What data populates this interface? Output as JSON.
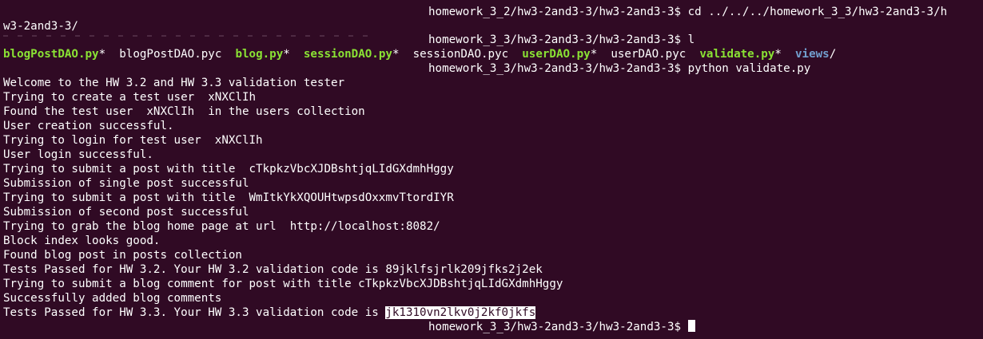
{
  "terminal": {
    "background": "#300a24",
    "foreground": "#ffffff",
    "colors": {
      "executable": "#8ae234",
      "directory": "#729fcf"
    },
    "cd_prompt": "homework_3_2/hw3-2and3-3/hw3-2and3-3$",
    "cd_command": "cd ../../../homework_3_3/hw3-2and3-3/h",
    "cd_wrap": "w3-2and3-3/",
    "ls_prompt": "homework_3_3/hw3-2and3-3/hw3-2and3-3$",
    "ls_command": "l",
    "ls_entries": [
      {
        "name": "blogPostDAO.py",
        "suffix": "*",
        "kind": "executable"
      },
      {
        "name": "blogPostDAO.pyc",
        "suffix": "",
        "kind": "file"
      },
      {
        "name": "blog.py",
        "suffix": "*",
        "kind": "executable"
      },
      {
        "name": "sessionDAO.py",
        "suffix": "*",
        "kind": "executable"
      },
      {
        "name": "sessionDAO.pyc",
        "suffix": "",
        "kind": "file"
      },
      {
        "name": "userDAO.py",
        "suffix": "*",
        "kind": "executable"
      },
      {
        "name": "userDAO.pyc",
        "suffix": "",
        "kind": "file"
      },
      {
        "name": "validate.py",
        "suffix": "*",
        "kind": "executable"
      },
      {
        "name": "views",
        "suffix": "/",
        "kind": "directory"
      }
    ],
    "run_prompt": "homework_3_3/hw3-2and3-3/hw3-2and3-3$",
    "run_command": "python validate.py",
    "output_lines": [
      "Welcome to the HW 3.2 and HW 3.3 validation tester",
      "Trying to create a test user  xNXClIh",
      "Found the test user  xNXClIh  in the users collection",
      "User creation successful.",
      "Trying to login for test user  xNXClIh",
      "User login successful.",
      "Trying to submit a post with title  cTkpkzVbcXJDBshtjqLIdGXdmhHggy",
      "Submission of single post successful",
      "Trying to submit a post with title  WmItkYkXQOUHtwpsdOxxmvTtordIYR",
      "Submission of second post successful",
      "Trying to grab the blog home page at url  http://localhost:8082/",
      "Block index looks good.",
      "Found blog post in posts collection",
      "Tests Passed for HW 3.2. Your HW 3.2 validation code is 89jklfsjrlk209jfks2j2ek",
      "Trying to submit a blog comment for post with title cTkpkzVbcXJDBshtjqLIdGXdmhHggy",
      "Successfully added blog comments"
    ],
    "final_prefix": "Tests Passed for HW 3.3. Your HW 3.3 validation code is ",
    "final_code": "jk1310vn2lkv0j2kf0jkfs",
    "end_prompt": "homework_3_3/hw3-2and3-3/hw3-2and3-3$"
  }
}
